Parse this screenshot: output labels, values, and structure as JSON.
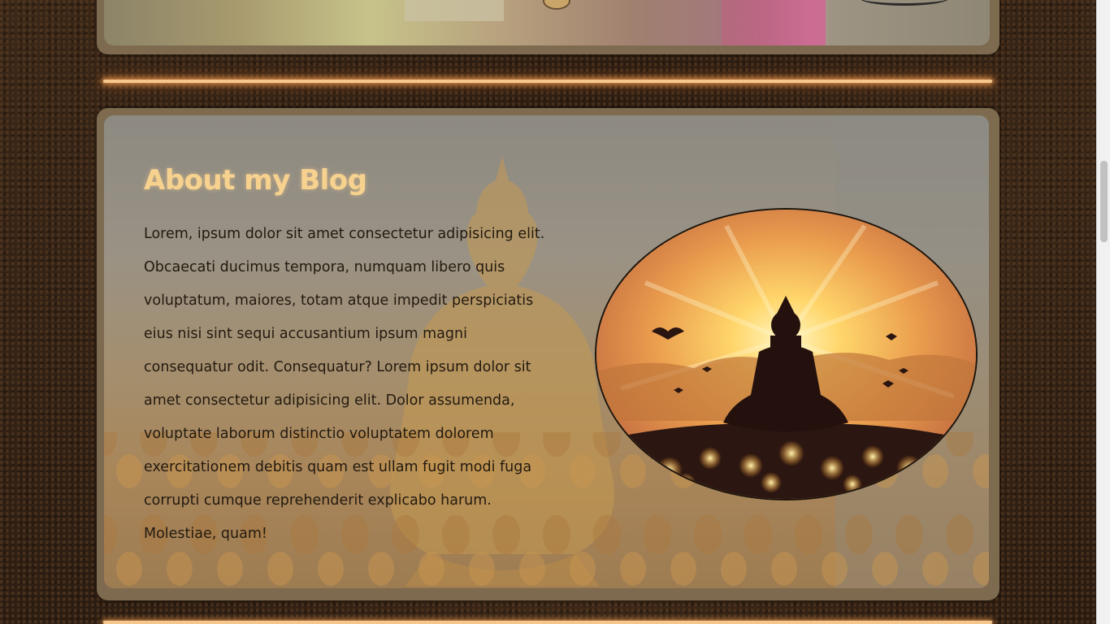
{
  "about": {
    "title": "About my Blog",
    "body": "Lorem, ipsum dolor sit amet consectetur adipisicing elit. Obcaecati ducimus tempora, numquam libero quis voluptatum, maiores, totam atque impedit perspiciatis eius nisi sint sequi accusantium ipsum magni consequatur odit. Consequatur? Lorem ipsum dolor sit amet consectetur adipisicing elit. Dolor assumenda, voluptate laborum distinctio voluptatem dolorem exercitationem debitis quam est ullam fugit modi fuga corrupti cumque reprehenderit explicabo harum. Molestiae, quam!",
    "image_icon": "meditating-buddha-sunset-image"
  },
  "colors": {
    "title": "#f7d28f",
    "glow": "#f6c78d",
    "card": "#7d6a4f",
    "text": "#231a10"
  }
}
